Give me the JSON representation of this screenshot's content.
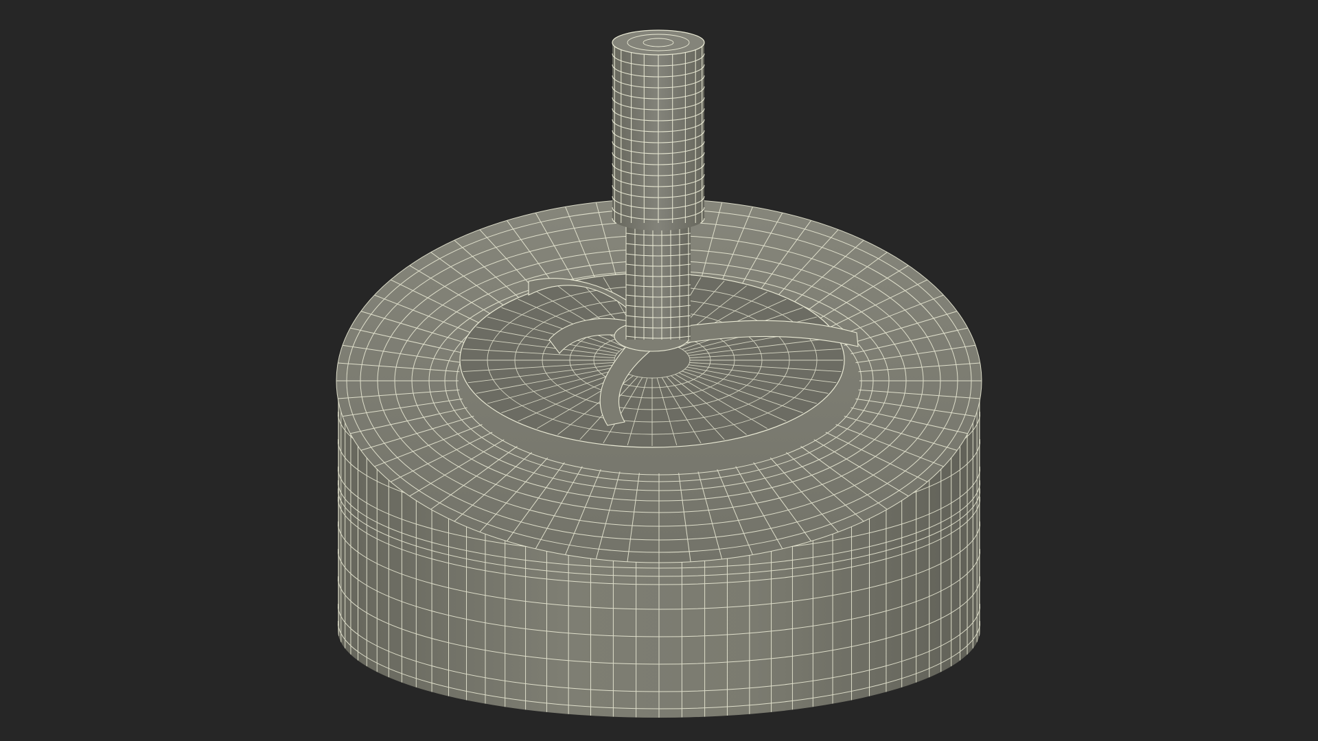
{
  "viewport": {
    "background": "#262626"
  },
  "model": {
    "subject": "wireframe-ashtray-icon",
    "surface_color": "#7b7b70",
    "surface_shadow": "#5f5f56",
    "surface_highlight": "#8d8d82",
    "wire_color": "#ebebd6",
    "wireframe_visible": true
  }
}
